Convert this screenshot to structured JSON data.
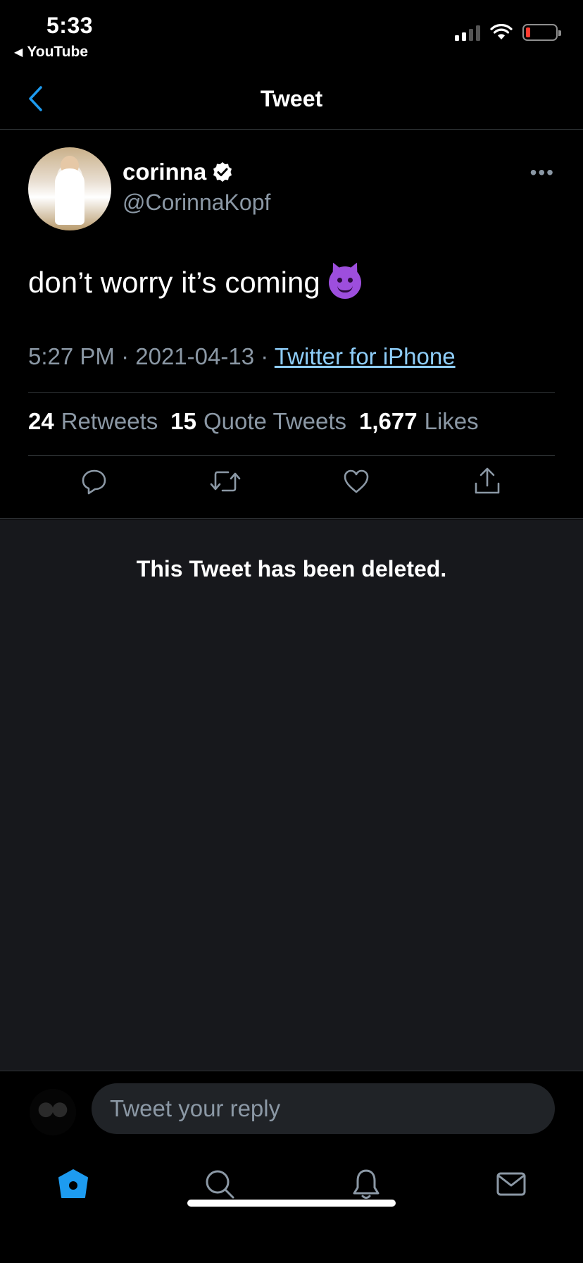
{
  "status_bar": {
    "time": "5:33",
    "back_app": "YouTube",
    "back_app_icon": "back-triangle-icon",
    "signal_bars_active": 2,
    "battery_level_percent": 10
  },
  "nav": {
    "title": "Tweet"
  },
  "tweet": {
    "author_name": "corinna",
    "author_handle": "@CorinnaKopf",
    "text": "don’t worry it’s coming",
    "emoji": "smiling-face-with-horns",
    "time": "5:27 PM",
    "separator": "·",
    "date": "2021-04-13",
    "source": "Twitter for iPhone",
    "stats": {
      "retweets_count": "24",
      "retweets_label": "Retweets",
      "quotes_count": "15",
      "quotes_label": "Quote Tweets",
      "likes_count": "1,677",
      "likes_label": "Likes"
    }
  },
  "deleted": {
    "message": "This Tweet has been deleted."
  },
  "reply": {
    "placeholder": "Tweet your reply"
  },
  "tabs": [
    "home",
    "search",
    "notifications",
    "messages"
  ],
  "colors": {
    "background": "#000000",
    "deleted_background": "#17181c",
    "accent": "#1d9bf0",
    "link": "#8ecdf8",
    "secondary_text": "#8b98a5",
    "divider": "#2f3336"
  }
}
